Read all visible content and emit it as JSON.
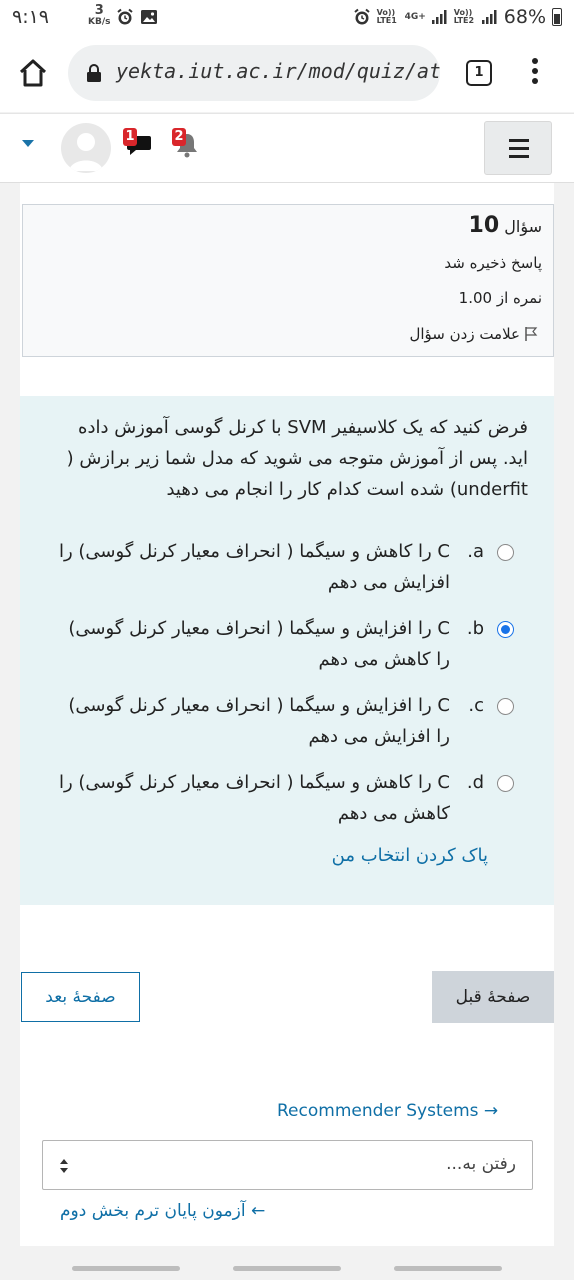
{
  "status_bar": {
    "time": "۹:۱۹",
    "net_speed_value": "3",
    "net_speed_unit": "KB/s",
    "sim1_label": "Vo)) LTE1",
    "sim2_label": "Vo)) LTE2",
    "network": "4G+",
    "battery": "68%"
  },
  "browser": {
    "url": "yekta.iut.ac.ir/mod/quiz/atte",
    "tab_count": "1"
  },
  "header": {
    "messages_badge": "1",
    "notifications_badge": "2"
  },
  "question_info": {
    "label": "سؤال",
    "number": "10",
    "state": "پاسخ ذخیره شد",
    "grade": "نمره از 1.00",
    "flag_label": "علامت زدن سؤال"
  },
  "question": {
    "text": "فرض کنید که یک کلاسیفیر SVM با کرنل گوسی آموزش داده اید. پس از آموزش متوجه می شوید که مدل شما زیر برازش ( underfit) شده است کدام کار را انجام می دهید",
    "answers": [
      {
        "letter": "a.",
        "text": "C را کاهش و سیگما ( انحراف معیار کرنل گوسی) را افزایش می دهم",
        "selected": false
      },
      {
        "letter": "b.",
        "text": "C را افزایش و سیگما ( انحراف معیار کرنل گوسی) را کاهش می دهم",
        "selected": true
      },
      {
        "letter": "c.",
        "text": "C را افزایش و سیگما ( انحراف معیار کرنل گوسی) را افزایش می دهم",
        "selected": false
      },
      {
        "letter": "d.",
        "text": "C را کاهش و سیگما ( انحراف معیار کرنل گوسی) را کاهش می دهم",
        "selected": false
      }
    ],
    "clear_choice": "پاک کردن انتخاب من"
  },
  "navigation": {
    "prev_page": "صفحهٔ قبل",
    "next_page": "صفحهٔ بعد",
    "next_activity": "Recommender Systems →",
    "jump_placeholder": "رفتن به...",
    "prev_activity": "← آزمون پایان ترم بخش دوم"
  },
  "colors": {
    "link": "#0f6fa6",
    "radio_selected": "#1a73e8",
    "badge": "#d9262b",
    "formulation_bg": "#e7f3f5"
  }
}
